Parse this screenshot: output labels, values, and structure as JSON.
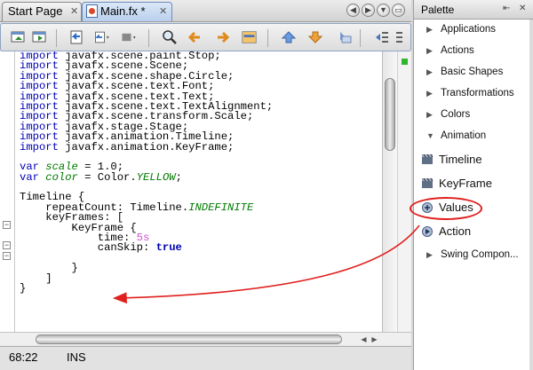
{
  "tabs": {
    "start": {
      "label": "Start Page",
      "close": "✕"
    },
    "main": {
      "label": "Main.fx *",
      "close": "✕"
    }
  },
  "code_lines": [
    [
      {
        "t": "import",
        "c": "kw"
      },
      {
        "t": " javafx.scene.paint.Stop;",
        "c": ""
      }
    ],
    [
      {
        "t": "import",
        "c": "kw"
      },
      {
        "t": " javafx.scene.Scene;",
        "c": ""
      }
    ],
    [
      {
        "t": "import",
        "c": "kw"
      },
      {
        "t": " javafx.scene.shape.Circle;",
        "c": ""
      }
    ],
    [
      {
        "t": "import",
        "c": "kw"
      },
      {
        "t": " javafx.scene.text.Font;",
        "c": ""
      }
    ],
    [
      {
        "t": "import",
        "c": "kw"
      },
      {
        "t": " javafx.scene.text.Text;",
        "c": ""
      }
    ],
    [
      {
        "t": "import",
        "c": "kw"
      },
      {
        "t": " javafx.scene.text.TextAlignment;",
        "c": ""
      }
    ],
    [
      {
        "t": "import",
        "c": "kw"
      },
      {
        "t": " javafx.scene.transform.Scale;",
        "c": ""
      }
    ],
    [
      {
        "t": "import",
        "c": "kw"
      },
      {
        "t": " javafx.stage.Stage;",
        "c": ""
      }
    ],
    [
      {
        "t": "import",
        "c": "kw"
      },
      {
        "t": " javafx.animation.Timeline;",
        "c": ""
      }
    ],
    [
      {
        "t": "import",
        "c": "kw"
      },
      {
        "t": " javafx.animation.KeyFrame;",
        "c": ""
      }
    ],
    [],
    [
      {
        "t": "var",
        "c": "kw"
      },
      {
        "t": " ",
        "c": ""
      },
      {
        "t": "scale",
        "c": "it"
      },
      {
        "t": " = 1.0;",
        "c": ""
      }
    ],
    [
      {
        "t": "var",
        "c": "kw"
      },
      {
        "t": " ",
        "c": ""
      },
      {
        "t": "color",
        "c": "it"
      },
      {
        "t": " = Color.",
        "c": ""
      },
      {
        "t": "YELLOW",
        "c": "it"
      },
      {
        "t": ";",
        "c": ""
      }
    ],
    [],
    [
      {
        "t": "Timeline {",
        "c": ""
      }
    ],
    [
      {
        "t": "    repeatCount: Timeline.",
        "c": ""
      },
      {
        "t": "INDEFINITE",
        "c": "it"
      }
    ],
    [
      {
        "t": "    keyFrames: [",
        "c": ""
      }
    ],
    [
      {
        "t": "        KeyFrame {",
        "c": ""
      }
    ],
    [
      {
        "t": "            time: ",
        "c": ""
      },
      {
        "t": "5s",
        "c": "num"
      }
    ],
    [
      {
        "t": "            canSkip: ",
        "c": ""
      },
      {
        "t": "true",
        "c": "bkw"
      }
    ],
    [],
    [
      {
        "t": "        }",
        "c": ""
      }
    ],
    [
      {
        "t": "    ]",
        "c": ""
      }
    ],
    [
      {
        "t": "}",
        "c": ""
      }
    ]
  ],
  "status": {
    "position": "68:22",
    "mode": "INS"
  },
  "palette": {
    "title": "Palette",
    "categories": [
      "Applications",
      "Actions",
      "Basic Shapes",
      "Transformations",
      "Colors",
      "Animation"
    ],
    "animation_items": [
      "Timeline",
      "KeyFrame",
      "Values",
      "Action"
    ],
    "last_category": "Swing Compon..."
  },
  "colors": {
    "annotation": "#e0201e",
    "keyword": "#0000b3",
    "italic_field": "#007a00",
    "duration": "#d14fd1"
  }
}
